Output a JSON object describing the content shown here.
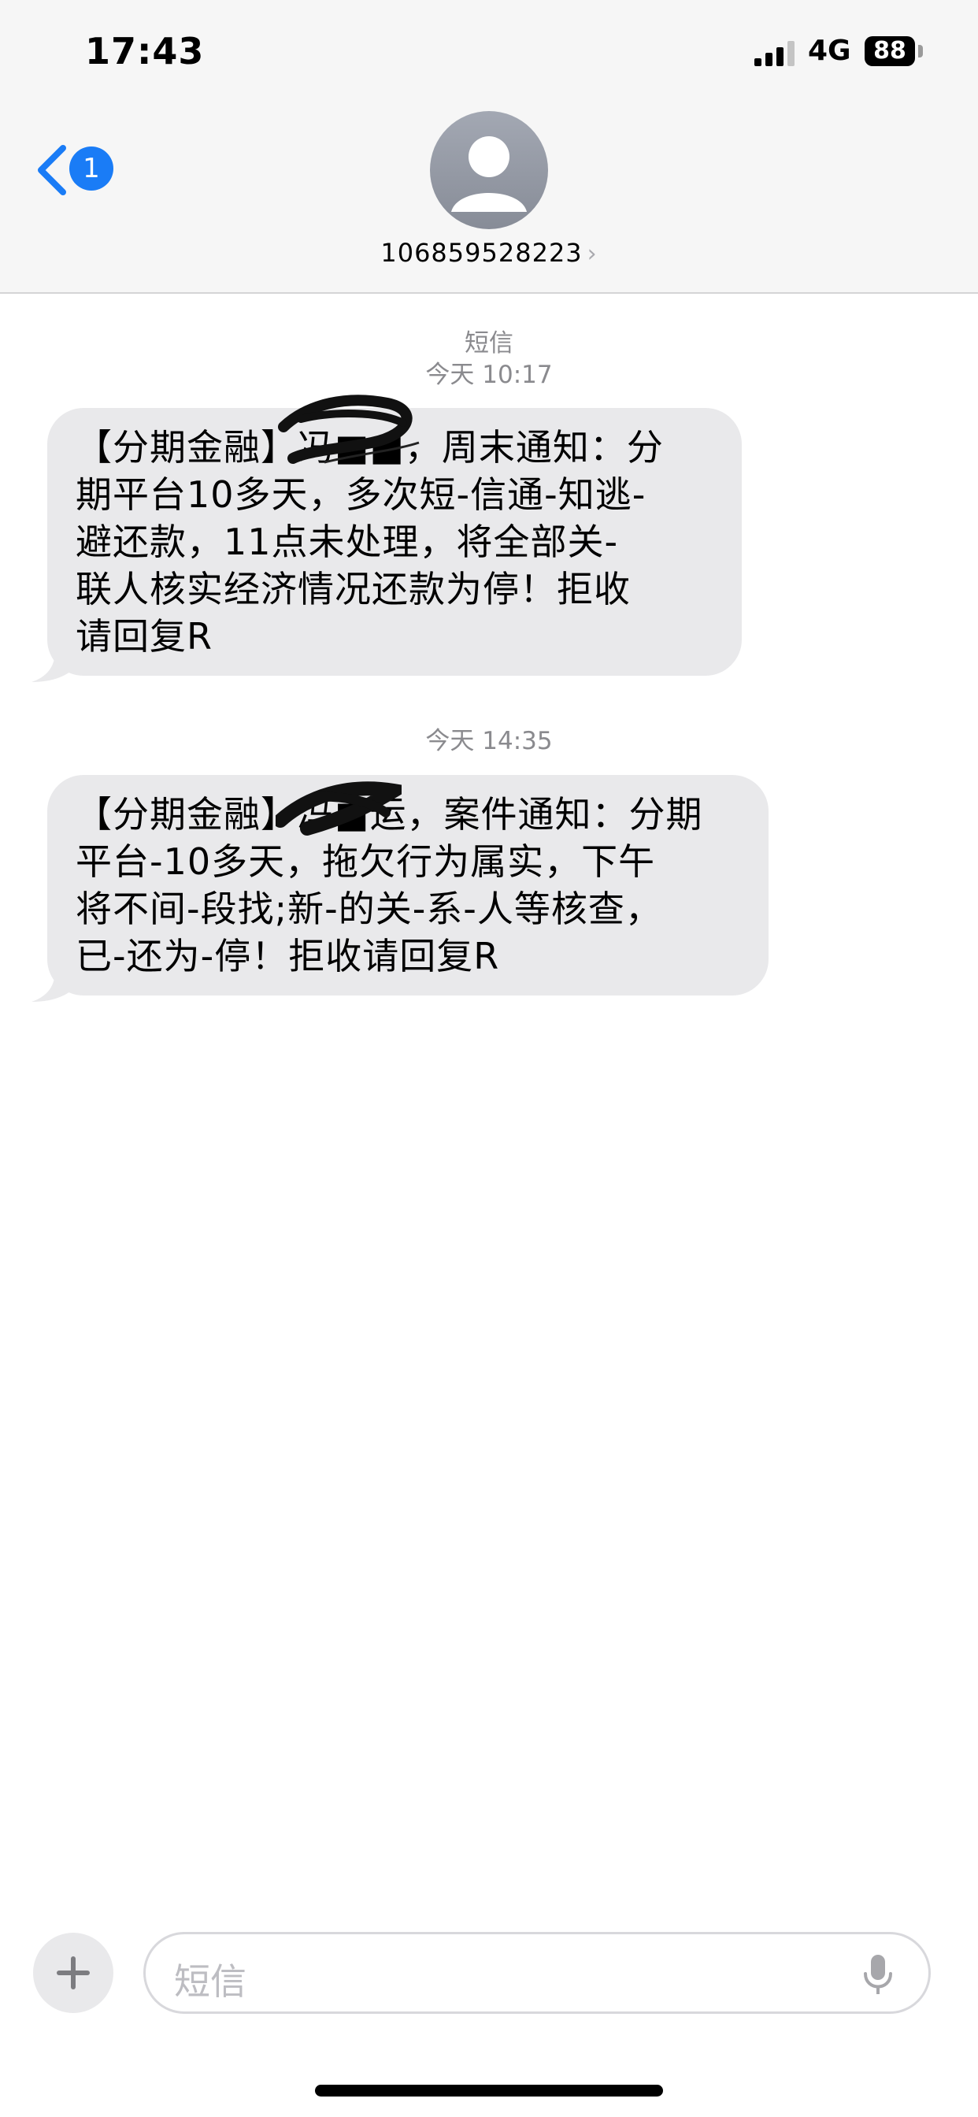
{
  "status_bar": {
    "time": "17:43",
    "network": "4G",
    "battery": "88"
  },
  "header": {
    "unread_count": "1",
    "contact": "106859528223"
  },
  "conversation": {
    "service_label": "短信",
    "messages": [
      {
        "timestamp": "今天 10:17",
        "lines": [
          "【分期金融】冯■■，周末通知：分",
          "期平台10多天，多次短-信通-知逃-",
          "避还款，11点未处理，将全部关-",
          "联人核实经济情况还款为停！拒收",
          "请回复R"
        ]
      },
      {
        "timestamp": "今天 14:35",
        "lines": [
          "【分期金融】冯■运，案件通知：分期",
          "平台-10多天，拖欠行为属实，下午",
          "将不间-段找;新-的关-系-人等核查，",
          "已-还为-停！拒收请回复R"
        ]
      }
    ]
  },
  "composer": {
    "placeholder": "短信"
  },
  "icons": {
    "signal": "signal-bars-icon",
    "back": "chevron-left-icon",
    "avatar": "person-icon",
    "plus": "plus-icon",
    "mic": "microphone-icon"
  },
  "colors": {
    "accent": "#1a7cf6",
    "bubble": "#e9e9eb",
    "header_bg": "#f6f6f6"
  }
}
